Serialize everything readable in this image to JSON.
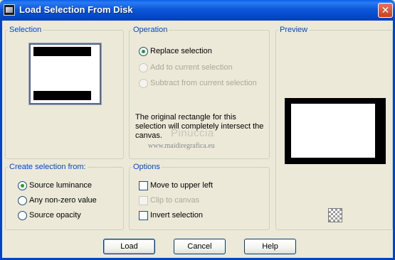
{
  "window": {
    "title": "Load Selection From Disk",
    "close_glyph": "✕"
  },
  "selection_group": {
    "legend": "Selection"
  },
  "operation_group": {
    "legend": "Operation",
    "options": [
      {
        "label": "Replace selection",
        "checked": true,
        "enabled": true
      },
      {
        "label": "Add to current selection",
        "checked": false,
        "enabled": false
      },
      {
        "label": "Subtract from current selection",
        "checked": false,
        "enabled": false
      }
    ],
    "info_text": "The original rectangle for this selection will completely intersect the canvas."
  },
  "watermark": {
    "line1": "Pinuccia",
    "line2": "www.maidiregrafica.eu"
  },
  "preview_group": {
    "legend": "Preview",
    "icon": "checkerboard-icon"
  },
  "create_group": {
    "legend": "Create selection from:",
    "options": [
      {
        "label": "Source luminance",
        "checked": true
      },
      {
        "label": "Any non-zero value",
        "checked": false
      },
      {
        "label": "Source opacity",
        "checked": false
      }
    ]
  },
  "options_group": {
    "legend": "Options",
    "items": [
      {
        "label": "Move to upper left",
        "checked": false,
        "enabled": true
      },
      {
        "label": "Clip to canvas",
        "checked": false,
        "enabled": false
      },
      {
        "label": "Invert selection",
        "checked": false,
        "enabled": true
      }
    ]
  },
  "buttons": {
    "load": "Load",
    "cancel": "Cancel",
    "help": "Help"
  },
  "colors": {
    "title_bar": "#0b58da",
    "group_legend": "#0046d5",
    "dialog_bg": "#ece9d8"
  }
}
